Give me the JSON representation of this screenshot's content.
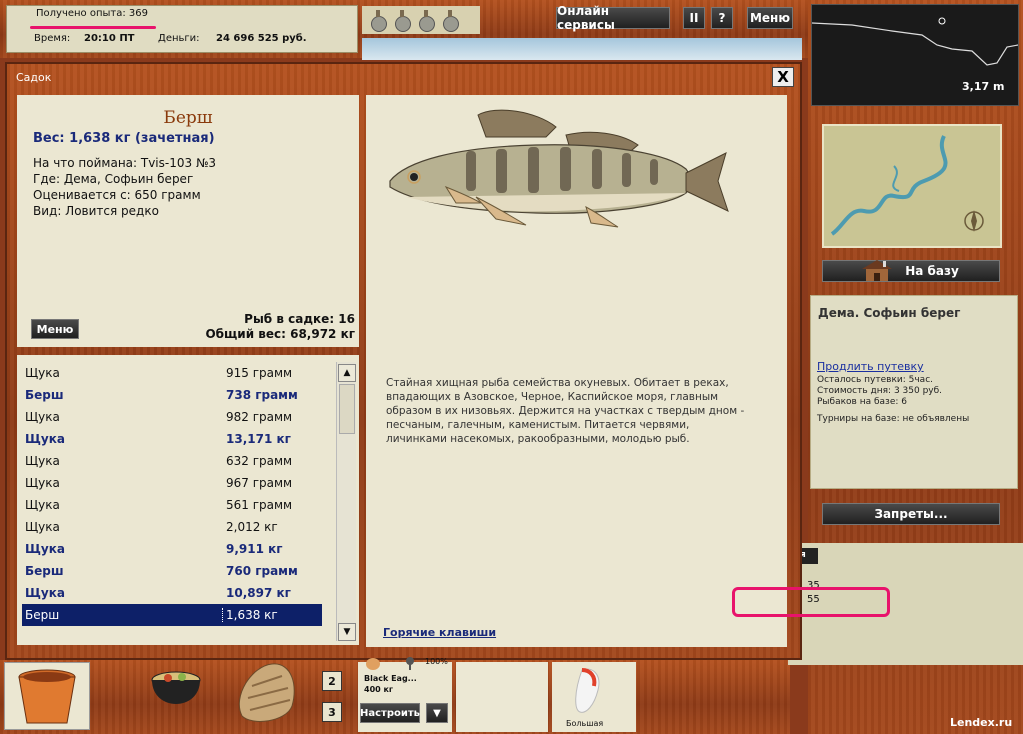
{
  "topbar": {
    "xp": "Получено опыта: 369",
    "time_label": "Время:",
    "time_value": "20:10 ПТ",
    "money_label": "Деньги:",
    "money_value": "24 696 525 руб.",
    "online_services": "Онлайн сервисы",
    "pause": "II",
    "help": "?",
    "menu": "Меню"
  },
  "depth": "3,17 m",
  "base_button": "На базу",
  "location": {
    "title": "Дема. Софьин берег",
    "extend_link": "Продлить путевку",
    "left": "Осталось путевки: 5час.",
    "cost": "Стоимость дня: 3 350 руб.",
    "fishers": "Рыбаков на базе: 6",
    "tournaments": "Турниры на базе: не объявлены"
  },
  "bans_button": "Запреты...",
  "lower_panel": {
    "tab": "гия",
    "n1": "35",
    "n2": "55"
  },
  "dialog": {
    "title": "Садок",
    "close": "X",
    "fish": {
      "name": "Берш",
      "weight": "Вес: 1,638 кг (зачетная)",
      "caught": "На что поймана: Tvis-103 №3",
      "where": "Где: Дема, Софьин берег",
      "rated": "Оценивается с: 650 грамм",
      "kind": "Вид: Ловится редко"
    },
    "menu_button": "Меню",
    "fish_count": "Рыб в садке: 16",
    "total_weight": "Общий вес: 68,972 кг",
    "list": [
      {
        "name": "Щука",
        "weight": "915 грамм"
      },
      {
        "name": "Берш",
        "weight": "738 грамм"
      },
      {
        "name": "Щука",
        "weight": "982 грамм"
      },
      {
        "name": "Щука",
        "weight": "13,171 кг"
      },
      {
        "name": "Щука",
        "weight": "632 грамм"
      },
      {
        "name": "Щука",
        "weight": "967 грамм"
      },
      {
        "name": "Щука",
        "weight": "561 грамм"
      },
      {
        "name": "Щука",
        "weight": "2,012 кг"
      },
      {
        "name": "Щука",
        "weight": "9,911 кг"
      },
      {
        "name": "Берш",
        "weight": "760 грамм"
      },
      {
        "name": "Щука",
        "weight": "10,897 кг"
      },
      {
        "name": "Берш",
        "weight": "1,638 кг"
      }
    ],
    "description": "Стайная хищная рыба семейства окуневых. Обитает в реках, впадающих в Азовское, Черное, Каспийское моря, главным образом в их низовьях. Держится на участках с твердым дном - песчаным, галечным, каменистым. Питается червями, личинками насекомых, ракообразными, молодью рыб.",
    "hotkeys": "Горячие клавиши"
  },
  "bottombar": {
    "slot2": "2",
    "slot3": "3",
    "tackle_name": "Black Eag...",
    "tackle_pct": "100%",
    "tackle_weight": "400 кг",
    "setup": "Настроить",
    "arrow": "▼",
    "lure_label": "Большая"
  },
  "watermark": "Lendex.ru"
}
